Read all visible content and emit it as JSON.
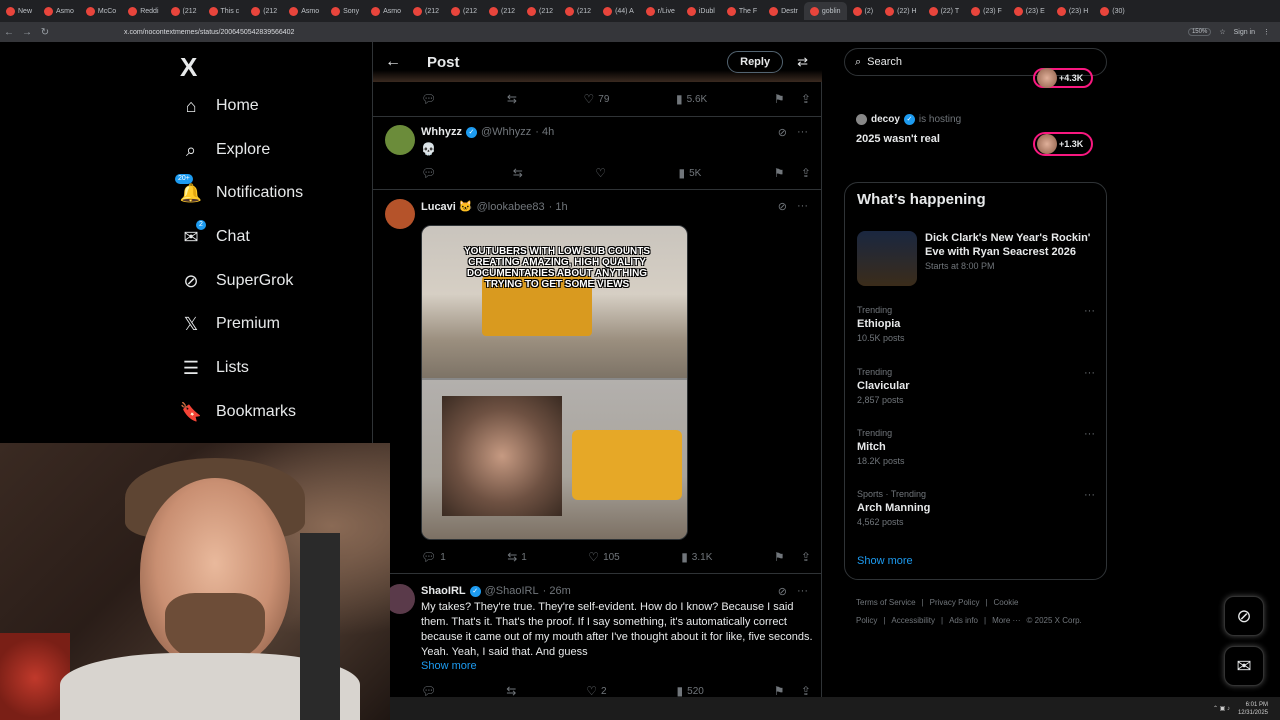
{
  "browser": {
    "tabs": [
      "New",
      "Asmo",
      "McCo",
      "Reddi",
      "(212",
      "This c",
      "(212",
      "Asmo",
      "Sony",
      "Asmo",
      "(212",
      "(212",
      "(212",
      "(212",
      "(212",
      "(44) A",
      "r/Live",
      "iDubl",
      "The F",
      "Destr",
      "goblin",
      "(2)",
      "(22) H",
      "(22) T",
      "(23) F",
      "(23) E",
      "(23) H",
      "(30)"
    ],
    "url": "x.com/nocontextmemes/status/2006450542839566402",
    "zoom": "150%",
    "signin": "Sign in"
  },
  "nav": {
    "logo": "X",
    "items": [
      {
        "label": "Home",
        "icon": "home-icon",
        "glyph": "⌂"
      },
      {
        "label": "Explore",
        "icon": "search-icon",
        "glyph": "⌕"
      },
      {
        "label": "Notifications",
        "icon": "bell-icon",
        "glyph": "🔔",
        "badge": "20+"
      },
      {
        "label": "Chat",
        "icon": "mail-icon",
        "glyph": "✉",
        "badge": "2"
      },
      {
        "label": "SuperGrok",
        "icon": "grok-icon",
        "glyph": "⊘"
      },
      {
        "label": "Premium",
        "icon": "x-premium-icon",
        "glyph": "𝕏"
      },
      {
        "label": "Lists",
        "icon": "list-icon",
        "glyph": "☰"
      },
      {
        "label": "Bookmarks",
        "icon": "bookmark-icon",
        "glyph": "🔖"
      }
    ]
  },
  "header": {
    "title": "Post",
    "reply": "Reply"
  },
  "prev_actions": {
    "replies": "",
    "reposts": "",
    "likes": "79",
    "views": "5.6K"
  },
  "tweets": [
    {
      "name": "Whhyzz",
      "handle": "@Whhyzz",
      "time": "· 4h",
      "text": "💀",
      "actions": {
        "replies": "",
        "reposts": "",
        "likes": "",
        "views": "5K"
      },
      "avatar_color": "#6b8c3a"
    },
    {
      "name": "Lucavi 🐱",
      "handle": "@lookabee83",
      "time": "· 1h",
      "meme_caption": "YOUTUBERS WITH LOW SUB COUNTS CREATING AMAZING, HIGH QUALITY DOCUMENTARIES ABOUT ANYTHING TRYING TO GET SOME VIEWS",
      "actions": {
        "replies": "1",
        "reposts": "1",
        "likes": "105",
        "views": "3.1K"
      },
      "avatar_color": "#b5532a"
    },
    {
      "name": "ShaoIRL",
      "handle": "@ShaoIRL",
      "time": "· 26m",
      "text": "My takes? They're true. They're self-evident. How do I know? Because I said them. That's it. That's the proof. If I say something, it's automatically correct because it came out of my mouth after I've thought about it for like, five seconds. Yeah. Yeah, I said that. And guess",
      "show_more": "Show more",
      "actions": {
        "replies": "",
        "reposts": "",
        "likes": "2",
        "views": "520"
      },
      "avatar_color": "#5a3a4a"
    }
  ],
  "right": {
    "search_placeholder": "Search",
    "live_top_count": "+4.3K",
    "host_name": "decoy",
    "host_label": "is hosting",
    "space_title": "2025 wasn't real",
    "space_count": "+1.3K",
    "happening_title": "What’s happening",
    "event": {
      "title": "Dick Clark's New Year's Rockin' Eve with Ryan Seacrest 2026",
      "time": "Starts at 8:00 PM"
    },
    "trends": [
      {
        "context": "Trending",
        "name": "Ethiopia",
        "count": "10.5K posts"
      },
      {
        "context": "Trending",
        "name": "Clavicular",
        "count": "2,857 posts"
      },
      {
        "context": "Trending",
        "name": "Mitch",
        "count": "18.2K posts"
      },
      {
        "context": "Sports · Trending",
        "name": "Arch Manning",
        "count": "4,562 posts"
      }
    ],
    "show_more": "Show more",
    "footer": [
      "Terms of Service",
      "|",
      "Privacy Policy",
      "|",
      "Cookie Policy",
      "|",
      "Accessibility",
      "|",
      "Ads info",
      "|",
      "More ···",
      "© 2025 X Corp."
    ]
  },
  "taskbar": {
    "time": "6:01 PM",
    "date": "12/31/2025"
  },
  "colors": {
    "accent": "#1d9bf0",
    "live": "#f91880",
    "bg": "#000000",
    "border": "#2f3336",
    "muted": "#71767b"
  }
}
